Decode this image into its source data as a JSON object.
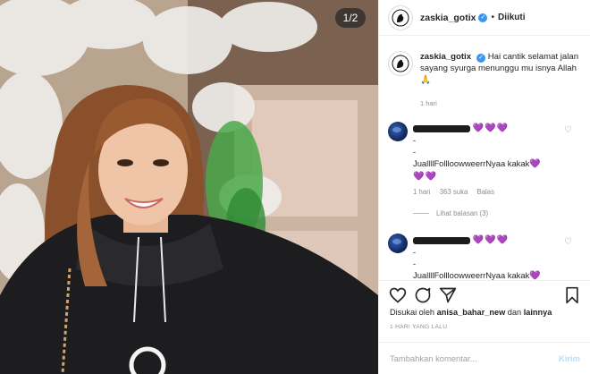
{
  "photo": {
    "counter": "1/2"
  },
  "header": {
    "username": "zaskia_gotix",
    "separator": "•",
    "follow_label": "Diikuti"
  },
  "caption": {
    "username": "zaskia_gotix",
    "text": "Hai cantik selamat jalan sayang syurga menunggu mu isnya Allah 🙏",
    "time": "1 hari"
  },
  "comments": [
    {
      "username_redacted": true,
      "hearts": "💜💜💜",
      "lines": [
        "-",
        "-",
        "JuallllFollloowweerrNyaa kakak"
      ],
      "hearts_inline": "💜",
      "hearts_after": "💜💜",
      "time": "1 hari",
      "likes": "363 suka",
      "reply": "Balas",
      "view_replies": "Lihat balasan (3)"
    },
    {
      "username_redacted": true,
      "hearts": "💜💜💜",
      "lines": [
        "-",
        "-",
        "JuallllFollloowweerrNyaa kakak"
      ],
      "hearts_inline": "💜"
    }
  ],
  "likes": {
    "prefix": "Disukai oleh",
    "user": "anisa_bahar_new",
    "suffix": "dan",
    "others": "lainnya"
  },
  "timestamp": "1 HARI YANG LALU",
  "composer": {
    "placeholder": "Tambahkan komentar...",
    "send_label": "Kirim"
  },
  "colors": {
    "accent": "#3897f0",
    "heart": "#6c4fc6",
    "send_disabled": "#b2dffc"
  }
}
